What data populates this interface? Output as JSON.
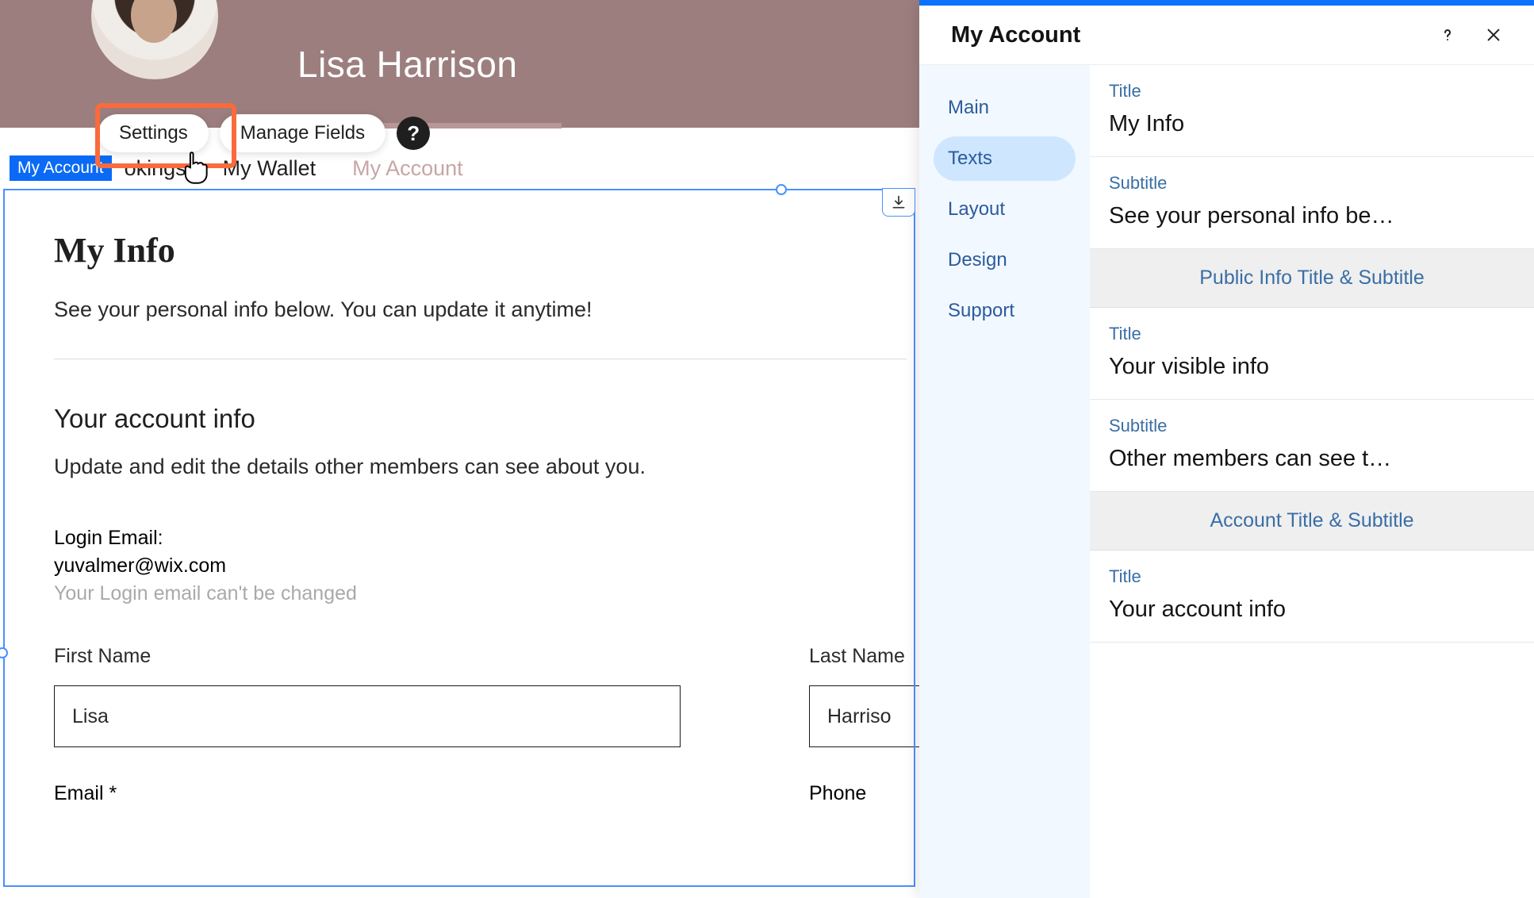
{
  "profile": {
    "name": "Lisa Harrison"
  },
  "toolbar": {
    "settings_label": "Settings",
    "manage_fields_label": "Manage Fields",
    "help_label": "?"
  },
  "nav": {
    "badge": "My Account",
    "item_okings": "okings",
    "item_wallet": "My Wallet",
    "item_account": "My Account"
  },
  "content": {
    "title": "My Info",
    "subtitle": "See your personal info below. You can update it anytime!",
    "account_title": "Your account info",
    "account_sub": "Update and edit the details other members can see about you.",
    "login_email_label": "Login Email:",
    "login_email_value": "yuvalmer@wix.com",
    "login_email_note": "Your Login email can't be changed",
    "first_name_label": "First Name",
    "first_name_value": "Lisa",
    "last_name_label": "Last Name",
    "last_name_value": "Harriso",
    "email_label": "Email *",
    "phone_label": "Phone"
  },
  "panel": {
    "title": "My Account",
    "side": {
      "main": "Main",
      "texts": "Texts",
      "layout": "Layout",
      "design": "Design",
      "support": "Support"
    },
    "fields": {
      "title_label": "Title",
      "title_value": "My Info",
      "subtitle_label": "Subtitle",
      "subtitle_value": "See your personal info be…",
      "public_section": "Public Info Title & Subtitle",
      "public_title_label": "Title",
      "public_title_value": "Your visible info",
      "public_subtitle_label": "Subtitle",
      "public_subtitle_value": "Other members can see t…",
      "account_section": "Account Title & Subtitle",
      "account_title_label": "Title",
      "account_title_value": "Your account info"
    }
  }
}
